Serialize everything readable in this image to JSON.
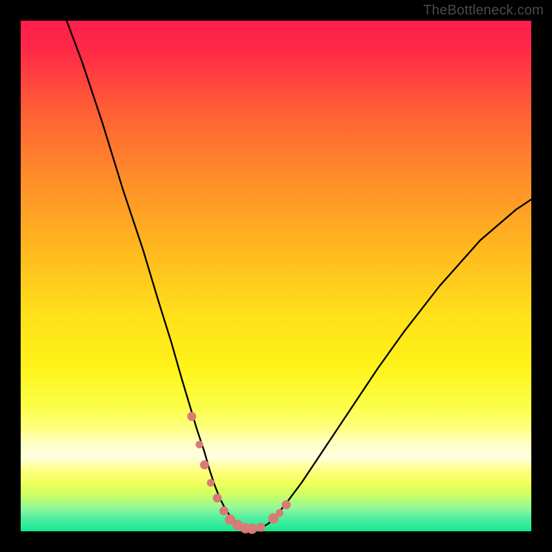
{
  "watermark": "TheBottleneck.com",
  "colors": {
    "black": "#000000",
    "curve": "#000000",
    "marker_fill": "#d87a75",
    "marker_stroke": "#d87a75",
    "grad_stops": [
      {
        "p": 0.0,
        "c": "#ff1d4d"
      },
      {
        "p": 0.06,
        "c": "#ff2a47"
      },
      {
        "p": 0.17,
        "c": "#ff5d36"
      },
      {
        "p": 0.3,
        "c": "#ff8a2a"
      },
      {
        "p": 0.45,
        "c": "#ffb91f"
      },
      {
        "p": 0.58,
        "c": "#ffe11a"
      },
      {
        "p": 0.68,
        "c": "#fff31a"
      },
      {
        "p": 0.76,
        "c": "#fbff4a"
      },
      {
        "p": 0.8,
        "c": "#ffff84"
      },
      {
        "p": 0.825,
        "c": "#ffffc2"
      },
      {
        "p": 0.855,
        "c": "#ffffe1"
      },
      {
        "p": 0.88,
        "c": "#ffff84"
      },
      {
        "p": 0.905,
        "c": "#f1ff5a"
      },
      {
        "p": 0.93,
        "c": "#caff66"
      },
      {
        "p": 0.955,
        "c": "#90f79a"
      },
      {
        "p": 0.975,
        "c": "#4eeea0"
      },
      {
        "p": 1.0,
        "c": "#15e890"
      }
    ]
  },
  "chart_data": {
    "type": "line",
    "title": "",
    "xlabel": "",
    "ylabel": "",
    "xlim": [
      0,
      100
    ],
    "ylim": [
      0,
      100
    ],
    "series": [
      {
        "name": "bottleneck-curve",
        "x": [
          9,
          12,
          16,
          20,
          24,
          27,
          29.5,
          31.5,
          33,
          34.5,
          36,
          37,
          38,
          39,
          40,
          41,
          42,
          43,
          44,
          45.5,
          47,
          48.5,
          50,
          52,
          55,
          58,
          62,
          66,
          70,
          75,
          82,
          90,
          97,
          100
        ],
        "y": [
          100,
          92,
          80,
          67,
          55,
          45,
          37,
          30,
          25,
          20,
          15.5,
          12,
          9,
          6.5,
          4.5,
          3,
          2,
          1.2,
          0.7,
          0.4,
          0.6,
          1.5,
          3,
          5.5,
          9.5,
          14,
          20,
          26,
          32,
          39,
          48,
          57,
          63,
          65
        ]
      }
    ],
    "markers": {
      "name": "highlighted-points",
      "x": [
        33.5,
        35,
        36,
        37.2,
        38.5,
        39.8,
        41,
        42.5,
        44,
        45.3,
        47,
        49.5,
        50.7,
        52
      ],
      "y": [
        22.5,
        17,
        13,
        9.5,
        6.5,
        4,
        2.3,
        1.2,
        0.6,
        0.5,
        0.8,
        2.5,
        3.6,
        5.2
      ],
      "r": [
        6,
        5,
        6,
        5,
        6,
        6,
        7,
        7,
        7,
        7,
        6,
        7,
        5,
        6
      ]
    }
  }
}
